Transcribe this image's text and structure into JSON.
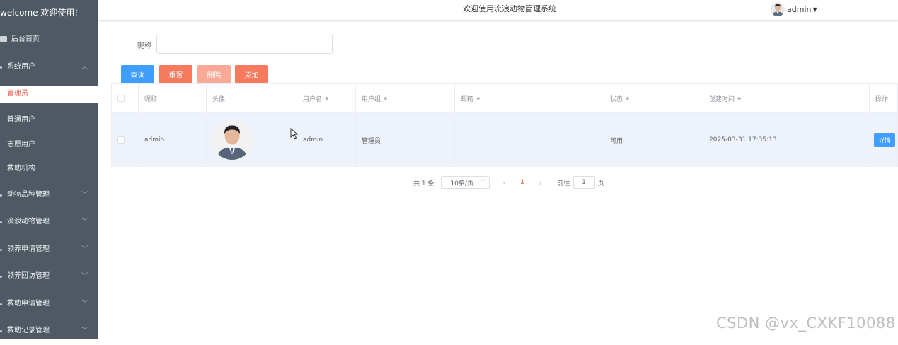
{
  "sidebar": {
    "welcome": "welcome 欢迎使用!",
    "home": "后台首页",
    "system_users": "系统用户",
    "sub_items": [
      "管理员",
      "普通用户",
      "志愿用户",
      "救助机构"
    ],
    "active_sub": "管理员",
    "menus": [
      "动物品种管理",
      "流浪动物管理",
      "领养申请管理",
      "领养回访管理",
      "救助申请管理",
      "救助记录管理"
    ]
  },
  "header": {
    "title": "欢迎使用流浪动物管理系统",
    "username": "admin"
  },
  "search": {
    "label": "昵称",
    "value": ""
  },
  "buttons": {
    "query": "查询",
    "reset": "重置",
    "delete": "删除",
    "add": "添加"
  },
  "table": {
    "headers": {
      "nickname": "昵称",
      "avatar": "头像",
      "username": "用户名",
      "group": "用户组",
      "email": "邮箱",
      "status": "状态",
      "created": "创建时间",
      "actions": "操作"
    },
    "rows": [
      {
        "nickname": "admin",
        "username": "admin",
        "group": "管理员",
        "email": "",
        "status": "可用",
        "created": "2025-03-31 17:35:13",
        "action": "详情"
      }
    ]
  },
  "pagination": {
    "total": "共 1 条",
    "page_size": "10条/页",
    "current_page": "1",
    "goto_prefix": "前往",
    "goto_value": "1",
    "goto_suffix": "页"
  },
  "watermark": "CSDN @vx_CXKF10088",
  "colors": {
    "sidebar_bg": "#4e5964",
    "primary": "#409eff",
    "accent": "#f67a5e"
  }
}
